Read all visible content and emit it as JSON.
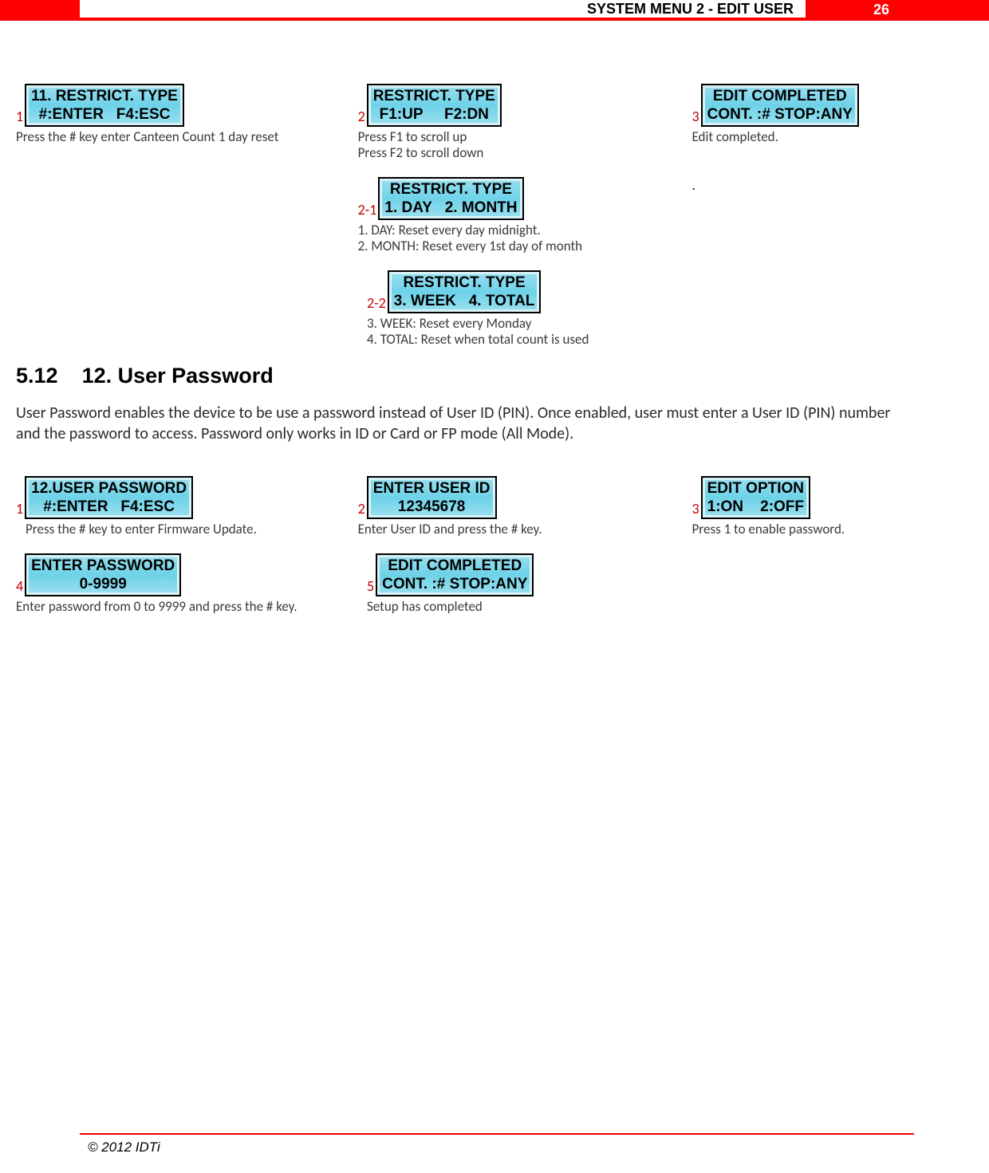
{
  "header": {
    "title": "SYSTEM MENU 2 - EDIT USER",
    "page_number": "26"
  },
  "section1": {
    "r1c1": {
      "num": "1",
      "lcd_line1": "11. RESTRICT. TYPE",
      "lcd_line2": "#:ENTER   F4:ESC",
      "caption": "Press the # key enter Canteen Count 1 day reset"
    },
    "r1c2": {
      "num": "2",
      "lcd_line1": "RESTRICT. TYPE",
      "lcd_line2": "F1:UP     F2:DN",
      "caption_l1": "Press F1 to scroll up",
      "caption_l2": "Press F2 to scroll down"
    },
    "r1c3": {
      "num": "3",
      "lcd_line1": "EDIT COMPLETED",
      "lcd_line2": "CONT. :# STOP:ANY",
      "caption": "Edit completed."
    },
    "r2c2": {
      "num": "2-1",
      "lcd_line1": "RESTRICT. TYPE",
      "lcd_line2": "1. DAY   2. MONTH",
      "caption_l1": "1. DAY: Reset every day midnight.",
      "caption_l2": "2. MONTH: Reset every 1st day of month"
    },
    "r2c3": {
      "dot": "."
    },
    "r3c2": {
      "num": "2-2",
      "lcd_line1": "RESTRICT. TYPE",
      "lcd_line2": "3. WEEK   4. TOTAL",
      "caption_l1": "3. WEEK: Reset every Monday",
      "caption_l2": "4. TOTAL: Reset when total count is used"
    }
  },
  "heading": {
    "number": "5.12",
    "title": "12. User Password"
  },
  "intro": "User Password enables the device to be use a password instead of User ID (PIN). Once enabled, user must enter a User ID (PIN) number and the password to access. Password only works in ID or Card or FP mode (All Mode).",
  "section2": {
    "r1c1": {
      "num": "1",
      "lcd_line1": "12.USER PASSWORD",
      "lcd_line2": "#:ENTER   F4:ESC",
      "caption": "Press the # key to enter Firmware Update."
    },
    "r1c2": {
      "num": "2",
      "lcd_line1": "ENTER USER ID",
      "lcd_line2": "12345678",
      "caption": "Enter User ID and press the # key."
    },
    "r1c3": {
      "num": "3",
      "lcd_line1": "EDIT OPTION",
      "lcd_line2": "1:ON    2:OFF",
      "caption": "Press 1 to enable password."
    },
    "r2c1": {
      "num": "4",
      "lcd_line1": "ENTER PASSWORD",
      "lcd_line2": "0-9999",
      "caption": "Enter password from 0 to 9999 and press the # key."
    },
    "r2c2": {
      "num": "5",
      "lcd_line1": "EDIT COMPLETED",
      "lcd_line2": "CONT. :# STOP:ANY",
      "caption": "Setup has completed"
    }
  },
  "footer": {
    "copyright": "© 2012 IDTi"
  }
}
